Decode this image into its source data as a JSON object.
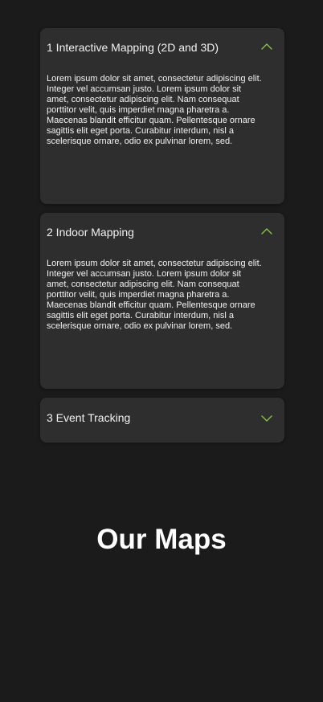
{
  "accent_color": "#8bc34a",
  "accordion": {
    "items": [
      {
        "title": "1 Interactive Mapping (2D and 3D)",
        "state": "expanded",
        "chevron_icon": "chevron-up-icon",
        "body": "Lorem ipsum dolor sit amet, consectetur adipiscing elit. Integer vel accumsan justo. Lorem ipsum dolor sit amet, consectetur adipiscing elit. Nam consequat porttitor velit, quis imperdiet magna pharetra a. Maecenas blandit efficitur quam. Pellentesque ornare sagittis elit eget porta. Curabitur interdum, nisl a scelerisque ornare, odio ex pulvinar lorem, sed."
      },
      {
        "title": "2 Indoor Mapping",
        "state": "expanded",
        "chevron_icon": "chevron-up-icon",
        "body": "Lorem ipsum dolor sit amet, consectetur adipiscing elit. Integer vel accumsan justo. Lorem ipsum dolor sit amet, consectetur adipiscing elit. Nam consequat porttitor velit, quis imperdiet magna pharetra a. Maecenas blandit efficitur quam. Pellentesque ornare sagittis elit eget porta. Curabitur interdum, nisl a scelerisque ornare, odio ex pulvinar lorem, sed."
      },
      {
        "title": "3 Event Tracking",
        "state": "collapsed",
        "chevron_icon": "chevron-down-icon"
      }
    ]
  },
  "section": {
    "heading": "Our Maps"
  }
}
